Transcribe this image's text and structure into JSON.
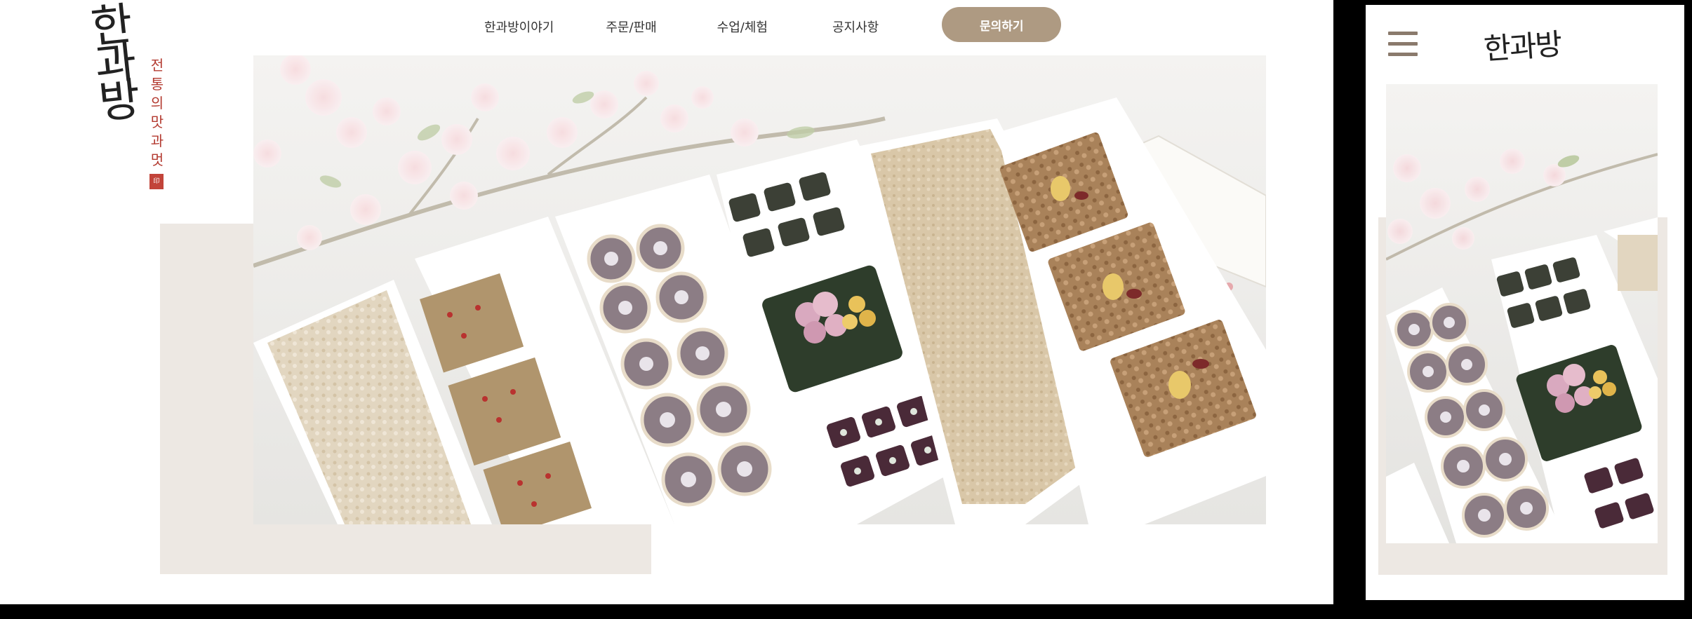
{
  "logo": {
    "main_chars": [
      "한",
      "과",
      "방"
    ],
    "tagline_chars": [
      "전",
      "통",
      "의",
      "맛",
      "과",
      "멋"
    ],
    "seal_text": "印"
  },
  "nav": {
    "items": [
      {
        "label": "한과방이야기"
      },
      {
        "label": "주문/판매"
      },
      {
        "label": "수업/체험"
      },
      {
        "label": "공지사항"
      }
    ],
    "cta_label": "문의하기"
  },
  "mobile": {
    "logo_text": "한과방",
    "menu_icon": "hamburger-menu-icon"
  },
  "colors": {
    "accent": "#ae9a82",
    "beige_block": "#ede8e3",
    "tagline_red": "#b33a30",
    "hamburger": "#8a7a6c"
  }
}
